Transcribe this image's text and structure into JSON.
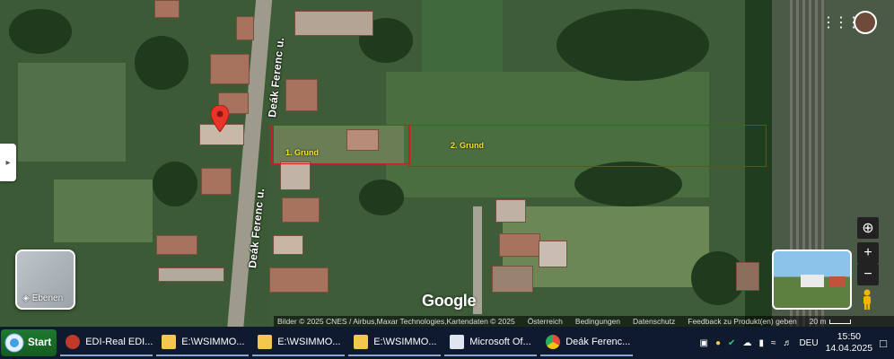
{
  "map": {
    "road_label_1": "Deák Ferenc u.",
    "road_label_2": "Deák Ferenc u.",
    "parcel_1_label": "1. Grund",
    "parcel_2_label": "2. Grund",
    "parcel_color": "#d11a1a",
    "parcel_label_color": "#f5e23a",
    "pin_color": "#e8352b",
    "layers_label": "Ebenen",
    "logo": "Google",
    "side_tab_icon": "chevron-right-icon",
    "apps_icon": "apps-grid-icon"
  },
  "footer": {
    "imagery": "Bilder © 2025 CNES / Airbus,Maxar Technologies,Kartendaten © 2025",
    "country": "Österreich",
    "terms": "Bedingungen",
    "privacy": "Datenschutz",
    "feedback": "Feedback zu Produkt(en) geben",
    "scale": "20 m"
  },
  "controls": {
    "zoom_in": "+",
    "zoom_out": "−"
  },
  "taskbar": {
    "start_label": "Start",
    "tasks": [
      {
        "label": "EDI-Real EDI...",
        "icon": "edi-real-icon",
        "color": "#c0392b"
      },
      {
        "label": "E:\\WSIMMO...",
        "icon": "folder-icon",
        "color": "#f2c94c"
      },
      {
        "label": "E:\\WSIMMO...",
        "icon": "folder-icon",
        "color": "#f2c94c"
      },
      {
        "label": "E:\\WSIMMO...",
        "icon": "folder-icon",
        "color": "#f2c94c"
      },
      {
        "label": "Microsoft Of...",
        "icon": "office-document-icon",
        "color": "#dfe6f0"
      },
      {
        "label": "Deák Ferenc...",
        "icon": "chrome-icon",
        "color": "#e74c3c"
      }
    ],
    "language": "DEU",
    "time": "15:50",
    "date": "14.04.2025"
  }
}
